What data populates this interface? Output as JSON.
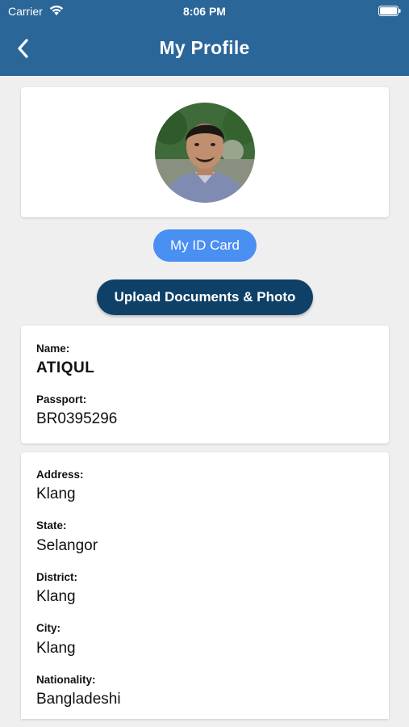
{
  "status_bar": {
    "carrier": "Carrier",
    "time": "8:06 PM"
  },
  "nav": {
    "title": "My Profile",
    "back_icon": "chevron-left-icon"
  },
  "buttons": {
    "id_card_label": "My ID Card",
    "upload_label": "Upload Documents & Photo"
  },
  "profile": {
    "name_label": "Name:",
    "name_value": "ATIQUL",
    "passport_label": "Passport:",
    "passport_value": "BR0395296"
  },
  "address": {
    "address_label": "Address:",
    "address_value": "Klang",
    "state_label": "State:",
    "state_value": "Selangor",
    "district_label": "District:",
    "district_value": "Klang",
    "city_label": "City:",
    "city_value": "Klang",
    "nationality_label": "Nationality:",
    "nationality_value": "Bangladeshi"
  },
  "colors": {
    "header": "#2b6698",
    "id_button": "#4a8ff2",
    "upload_button": "#0f4068",
    "background": "#efefef"
  }
}
